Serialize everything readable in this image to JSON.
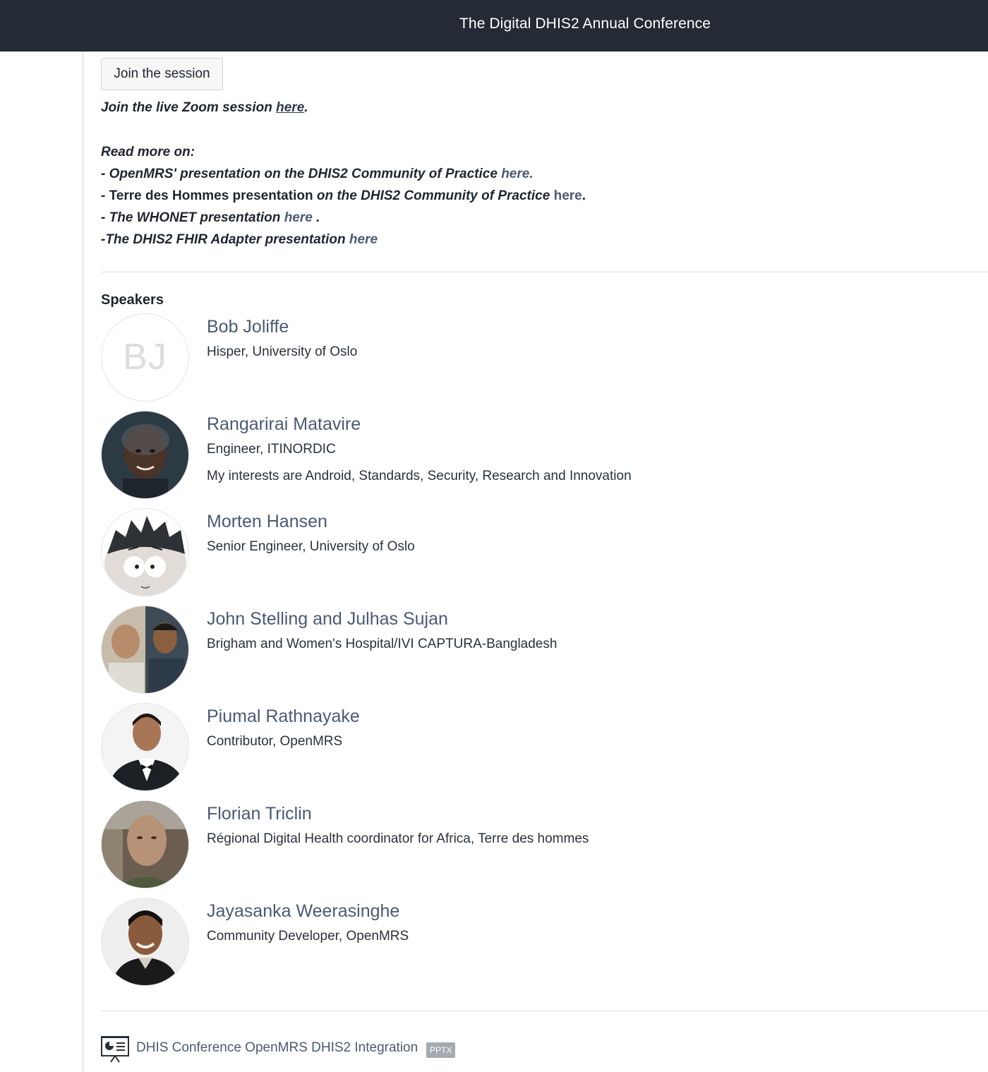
{
  "header": {
    "title": "The Digital DHIS2 Annual Conference"
  },
  "session": {
    "join_button": "Join the session",
    "zoom_text": "Join the live Zoom session ",
    "zoom_link": "here",
    "zoom_end": "."
  },
  "read_more": {
    "heading": "Read more on:",
    "items": [
      {
        "text": "- OpenMRS' presentation on the DHIS2 Community of Practice  ",
        "link": "here.",
        "end": ""
      },
      {
        "text_normal": "- Terre des Hommes presentation ",
        "text": "on the DHIS2 Community of Practice ",
        "link": "here",
        "end": "."
      },
      {
        "text": "- The WHONET presentation ",
        "link": "here",
        "end": " ."
      },
      {
        "text": "-The DHIS2 FHIR Adapter presentation ",
        "link": "here",
        "end": ""
      }
    ]
  },
  "speakers": {
    "heading": "Speakers",
    "list": [
      {
        "name": "Bob Joliffe",
        "role": "Hisper, University of Oslo",
        "bio": "",
        "initials": "BJ"
      },
      {
        "name": "Rangarirai Matavire",
        "role": "Engineer, ITINORDIC",
        "bio": "My interests are Android, Standards, Security, Research and Innovation"
      },
      {
        "name": "Morten Hansen",
        "role": "Senior Engineer, University of Oslo",
        "bio": ""
      },
      {
        "name": "John Stelling and Julhas Sujan",
        "role": "Brigham and Women's Hospital/IVI CAPTURA-Bangladesh",
        "bio": ""
      },
      {
        "name": "Piumal Rathnayake",
        "role": "Contributor, OpenMRS",
        "bio": ""
      },
      {
        "name": "Florian Triclin",
        "role": "Régional Digital Health coordinator for Africa, Terre des hommes",
        "bio": ""
      },
      {
        "name": "Jayasanka Weerasinghe",
        "role": "Community Developer, OpenMRS",
        "bio": ""
      }
    ]
  },
  "attachment": {
    "icon": "presentation-icon",
    "name": "DHIS Conference OpenMRS DHIS2 Integration",
    "badge": "PPTX"
  }
}
